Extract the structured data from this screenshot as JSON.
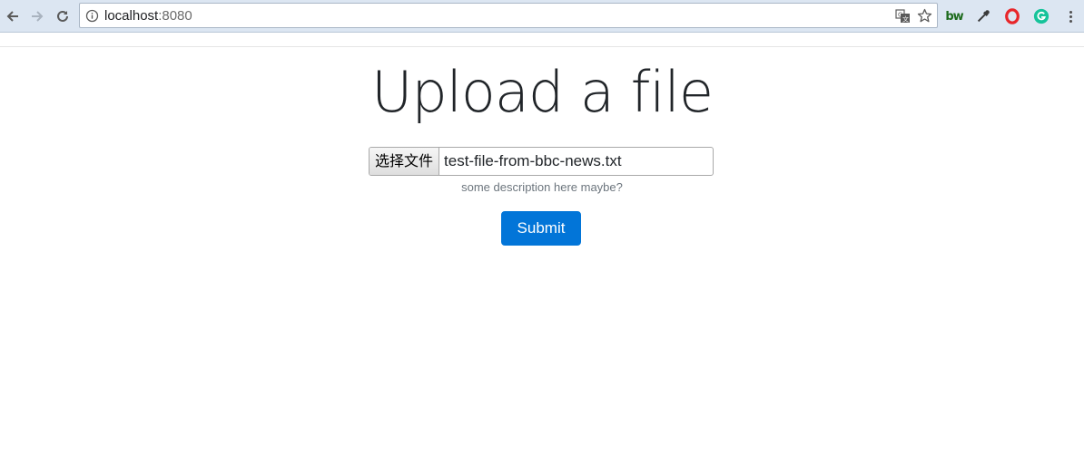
{
  "browser": {
    "url_host": "localhost",
    "url_port": ":8080",
    "icons": [
      "back-arrow-icon",
      "forward-arrow-icon",
      "reload-icon",
      "info-icon",
      "translate-icon",
      "star-icon",
      "bw-extension-icon",
      "eyedropper-icon",
      "opera-icon",
      "grammarly-icon",
      "menu-dots-icon"
    ],
    "bw_label": "bw",
    "colors": {
      "toolbar": "#dce6f2",
      "opera": "#e8262a",
      "grammarly": "#15c39a"
    }
  },
  "page": {
    "title": "Upload a file",
    "file_input": {
      "button_label": "选择文件",
      "file_name": "test-file-from-bbc-news.txt"
    },
    "help_text": "some description here maybe?",
    "submit_label": "Submit",
    "colors": {
      "primary": "#0275d8",
      "muted": "#6c757d"
    }
  }
}
